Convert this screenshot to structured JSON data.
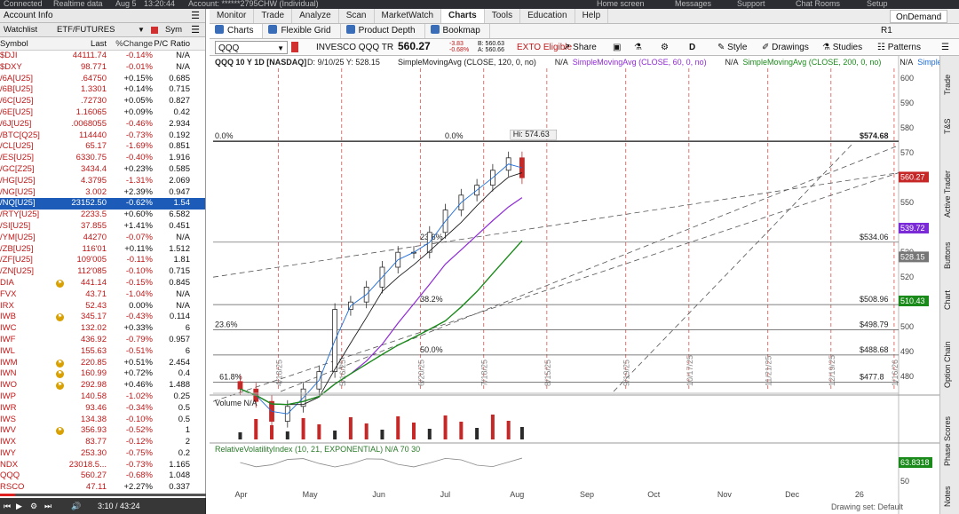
{
  "topstrip": {
    "connected": "Connected",
    "realtime": "Realtime data",
    "date": "Aug 5",
    "time": "13:20:44",
    "account": "Account: ******2795CHW (Individual)",
    "home": "Home screen",
    "messages": "Messages",
    "support": "Support",
    "chat": "Chat Rooms",
    "setup": "Setup"
  },
  "left": {
    "account_info": "Account Info",
    "watchlist_label": "Watchlist",
    "watchlist_name": "ETF/FUTURES",
    "sym_label": "Sym",
    "columns": [
      "Symbol",
      "Last",
      "%Change",
      "P/C Ratio"
    ],
    "rows": [
      {
        "sym": "$DJI",
        "last": "44111.74",
        "chg": "-0.14%",
        "pc": "N/A"
      },
      {
        "sym": "$DXY",
        "last": "98.771",
        "chg": "-0.01%",
        "pc": "N/A"
      },
      {
        "sym": "/6A[U25]",
        "last": ".64750",
        "chg": "+0.15%",
        "pc": "0.685"
      },
      {
        "sym": "/6B[U25]",
        "last": "1.3301",
        "chg": "+0.14%",
        "pc": "0.715"
      },
      {
        "sym": "/6C[U25]",
        "last": ".72730",
        "chg": "+0.05%",
        "pc": "0.827"
      },
      {
        "sym": "/6E[U25]",
        "last": "1.16065",
        "chg": "+0.09%",
        "pc": "0.42"
      },
      {
        "sym": "/6J[U25]",
        "last": ".0068055",
        "chg": "-0.46%",
        "pc": "2.934"
      },
      {
        "sym": "/BTC[Q25]",
        "last": "114440",
        "chg": "-0.73%",
        "pc": "0.192"
      },
      {
        "sym": "/CL[U25]",
        "last": "65.17",
        "chg": "-1.69%",
        "pc": "0.851"
      },
      {
        "sym": "/ES[U25]",
        "last": "6330.75",
        "chg": "-0.40%",
        "pc": "1.916"
      },
      {
        "sym": "/GC[Z25]",
        "last": "3434.4",
        "chg": "+0.23%",
        "pc": "0.585"
      },
      {
        "sym": "/HG[U25]",
        "last": "4.3795",
        "chg": "-1.31%",
        "pc": "2.069"
      },
      {
        "sym": "/NG[U25]",
        "last": "3.002",
        "chg": "+2.39%",
        "pc": "0.947"
      },
      {
        "sym": "/NQ[U25]",
        "last": "23152.50",
        "chg": "-0.62%",
        "pc": "1.54"
      },
      {
        "sym": "/RTY[U25]",
        "last": "2233.5",
        "chg": "+0.60%",
        "pc": "6.582"
      },
      {
        "sym": "/SI[U25]",
        "last": "37.855",
        "chg": "+1.41%",
        "pc": "0.451"
      },
      {
        "sym": "/YM[U25]",
        "last": "44270",
        "chg": "-0.07%",
        "pc": "N/A"
      },
      {
        "sym": "/ZB[U25]",
        "last": "116'01",
        "chg": "+0.11%",
        "pc": "1.512"
      },
      {
        "sym": "/ZF[U25]",
        "last": "109'005",
        "chg": "-0.11%",
        "pc": "1.81"
      },
      {
        "sym": "/ZN[U25]",
        "last": "112'085",
        "chg": "-0.10%",
        "pc": "0.715"
      },
      {
        "sym": "DIA",
        "last": "441.14",
        "chg": "-0.15%",
        "pc": "0.845"
      },
      {
        "sym": "FVX",
        "last": "43.71",
        "chg": "-1.04%",
        "pc": "N/A"
      },
      {
        "sym": "IRX",
        "last": "52.43",
        "chg": "0.00%",
        "pc": "N/A"
      },
      {
        "sym": "IWB",
        "last": "345.17",
        "chg": "-0.43%",
        "pc": "0.114"
      },
      {
        "sym": "IWC",
        "last": "132.02",
        "chg": "+0.33%",
        "pc": "6"
      },
      {
        "sym": "IWF",
        "last": "436.92",
        "chg": "-0.79%",
        "pc": "0.957"
      },
      {
        "sym": "IWL",
        "last": "155.63",
        "chg": "-0.51%",
        "pc": "6"
      },
      {
        "sym": "IWM",
        "last": "220.85",
        "chg": "+0.51%",
        "pc": "2.454"
      },
      {
        "sym": "IWN",
        "last": "160.99",
        "chg": "+0.72%",
        "pc": "0.4"
      },
      {
        "sym": "IWO",
        "last": "292.98",
        "chg": "+0.46%",
        "pc": "1.488"
      },
      {
        "sym": "IWP",
        "last": "140.58",
        "chg": "-1.02%",
        "pc": "0.25"
      },
      {
        "sym": "IWR",
        "last": "93.46",
        "chg": "-0.34%",
        "pc": "0.5"
      },
      {
        "sym": "IWS",
        "last": "134.38",
        "chg": "-0.10%",
        "pc": "0.5"
      },
      {
        "sym": "IWV",
        "last": "356.93",
        "chg": "-0.52%",
        "pc": "1"
      },
      {
        "sym": "IWX",
        "last": "83.77",
        "chg": "-0.12%",
        "pc": "2"
      },
      {
        "sym": "IWY",
        "last": "253.30",
        "chg": "-0.75%",
        "pc": "0.2"
      },
      {
        "sym": "NDX",
        "last": "23018.5...",
        "chg": "-0.73%",
        "pc": "1.165"
      },
      {
        "sym": "QQQ",
        "last": "560.27",
        "chg": "-0.68%",
        "pc": "1.048"
      },
      {
        "sym": "RSCO",
        "last": "47.11",
        "chg": "+2.27%",
        "pc": "0.337"
      }
    ],
    "badge_symbols": [
      "DIA",
      "IWB",
      "IWM",
      "IWN",
      "IWO",
      "IWV"
    ],
    "selected_symbol": "/NQ[U25]"
  },
  "video": {
    "time": "3:10 / 43:24",
    "progress": 0.073
  },
  "nav": {
    "tabs": [
      "Monitor",
      "Trade",
      "Analyze",
      "Scan",
      "MarketWatch",
      "Charts",
      "Tools",
      "Education",
      "Help"
    ],
    "active": "Charts",
    "ondemand": "OnDemand"
  },
  "subtabs": {
    "items": [
      "Charts",
      "Flexible Grid",
      "Product Depth",
      "Bookmap"
    ],
    "active": "Charts",
    "r1": "R1"
  },
  "toolbar": {
    "symbol": "QQQ",
    "name": "INVESCO QQQ TR",
    "price": "560.27",
    "change": "-3.83",
    "change_pct": "-0.68%",
    "bid": "B: 560.63",
    "ask": "A: 560.66",
    "exto": "EXTO Eligible",
    "share": "Share",
    "d": "D",
    "style": "Style",
    "drawings": "Drawings",
    "studies": "Studies",
    "patterns": "Patterns"
  },
  "chart_data": {
    "type": "candlestick",
    "header": "QQQ 10 Y 1D [NASDAQ]",
    "cursor": "D: 9/10/25  Y: 528.15",
    "studies_legend": [
      {
        "text": "SimpleMovingAvg (CLOSE, 120, 0, no)",
        "value": "N/A",
        "color": "#1a1a1a"
      },
      {
        "text": "SimpleMovingAvg (CLOSE, 60, 0, no)",
        "value": "N/A",
        "color": "#8e2ad6"
      },
      {
        "text": "SimpleMovingAvg (CLOSE, 200, 0, no)",
        "value": "N/A",
        "color": "#1a8a1a"
      },
      {
        "text": "Simple...",
        "value": "",
        "color": "#1a6ad6"
      }
    ],
    "ylim": [
      474,
      604
    ],
    "y_ticks": [
      600,
      590,
      580,
      570,
      560,
      550,
      540,
      530,
      520,
      510,
      500,
      490,
      480
    ],
    "x_months": [
      {
        "label": "Apr",
        "date": "2025-04-01"
      },
      {
        "label": "May",
        "date": "2025-05-01"
      },
      {
        "label": "Jun",
        "date": "2025-06-01"
      },
      {
        "label": "Jul",
        "date": "2025-07-01"
      },
      {
        "label": "Aug",
        "date": "2025-08-01"
      },
      {
        "label": "Sep",
        "date": "2025-09-01"
      },
      {
        "label": "Oct",
        "date": "2025-10-01"
      },
      {
        "label": "Nov",
        "date": "2025-11-01"
      },
      {
        "label": "Dec",
        "date": "2025-12-01"
      },
      {
        "label": "26",
        "date": "2026-01-01"
      }
    ],
    "x_range": [
      "2025-03-20",
      "2026-01-18"
    ],
    "cursor_date_label": "9/10",
    "vlines": [
      {
        "label": "4/18/25",
        "date": "2025-04-18"
      },
      {
        "label": "5/16/25",
        "date": "2025-05-16"
      },
      {
        "label": "6/20/25",
        "date": "2025-06-20"
      },
      {
        "label": "7/18/25",
        "date": "2025-07-18"
      },
      {
        "label": "8/15/25",
        "date": "2025-08-15"
      },
      {
        "label": "9/19/25",
        "date": "2025-09-19"
      },
      {
        "label": "10/17/25",
        "date": "2025-10-17"
      },
      {
        "label": "11/21/25",
        "date": "2025-11-21"
      },
      {
        "label": "12/19/25",
        "date": "2025-12-19"
      },
      {
        "label": "1/16/26",
        "date": "2026-01-16"
      }
    ],
    "hlines": [
      {
        "value": 574.68,
        "label": "$574.68",
        "color": "#111",
        "bold": true
      },
      {
        "value": 534.06,
        "label": "$534.06",
        "color": "#555",
        "bold": false
      },
      {
        "value": 508.96,
        "label": "$508.96",
        "color": "#555",
        "bold": false
      },
      {
        "value": 498.79,
        "label": "$498.79",
        "color": "#555",
        "bold": false
      },
      {
        "value": 488.68,
        "label": "$488.68",
        "color": "#555",
        "bold": false
      },
      {
        "value": 477.8,
        "label": "$477.8",
        "color": "#555",
        "bold": false
      }
    ],
    "fib_labels": [
      {
        "text": "0.0%",
        "date": "2025-03-20",
        "value": 574.68
      },
      {
        "text": "0.0%",
        "date": "2025-06-30",
        "value": 574.68
      },
      {
        "text": "23.6%",
        "date": "2025-03-20",
        "value": 498.79
      },
      {
        "text": "23.6%",
        "date": "2025-06-19",
        "value": 534.06
      },
      {
        "text": "38.2%",
        "date": "2025-06-19",
        "value": 508.96
      },
      {
        "text": "50.0%",
        "date": "2025-06-19",
        "value": 488.68
      },
      {
        "text": "61.8%",
        "date": "2025-03-22",
        "value": 477.8
      }
    ],
    "hi_label": {
      "text": "Hi: 574.63",
      "date": "2025-07-31",
      "value": 574.63
    },
    "price_tags": [
      {
        "value": 560.27,
        "label": "560.27",
        "color": "#c62828"
      },
      {
        "value": 539.72,
        "label": "539.72",
        "color": "#7a2ad6"
      },
      {
        "value": 528.15,
        "label": "528.15",
        "color": "#777"
      },
      {
        "value": 510.43,
        "label": "510.43",
        "color": "#1a8a1a"
      }
    ],
    "candles": [
      {
        "d": "2025-04-01",
        "c": 475
      },
      {
        "d": "2025-04-08",
        "c": 470
      },
      {
        "d": "2025-04-15",
        "c": 462
      },
      {
        "d": "2025-04-22",
        "c": 468
      },
      {
        "d": "2025-04-29",
        "c": 475
      },
      {
        "d": "2025-05-06",
        "c": 482
      },
      {
        "d": "2025-05-13",
        "c": 507
      },
      {
        "d": "2025-05-20",
        "c": 510
      },
      {
        "d": "2025-05-27",
        "c": 516
      },
      {
        "d": "2025-06-03",
        "c": 524
      },
      {
        "d": "2025-06-10",
        "c": 530
      },
      {
        "d": "2025-06-17",
        "c": 530
      },
      {
        "d": "2025-06-24",
        "c": 538
      },
      {
        "d": "2025-07-01",
        "c": 547
      },
      {
        "d": "2025-07-08",
        "c": 553
      },
      {
        "d": "2025-07-15",
        "c": 557
      },
      {
        "d": "2025-07-22",
        "c": 563
      },
      {
        "d": "2025-07-29",
        "c": 568
      },
      {
        "d": "2025-08-04",
        "c": 560
      }
    ],
    "volume": {
      "label": "Volume",
      "value": "N/A"
    },
    "rvi": {
      "label": "RelativeVolatilityIndex (10, 21, EXPONENTIAL)",
      "value": "N/A",
      "levels": "70  30",
      "current": "63.8318",
      "right_tick": "50"
    }
  },
  "right_tabs": [
    "Trade",
    "T&S",
    "Active Trader",
    "Buttons",
    "Chart",
    "Option Chain",
    "Phase Scores",
    "Notes"
  ],
  "footer": {
    "drawing_set": "Drawing set: Default"
  }
}
